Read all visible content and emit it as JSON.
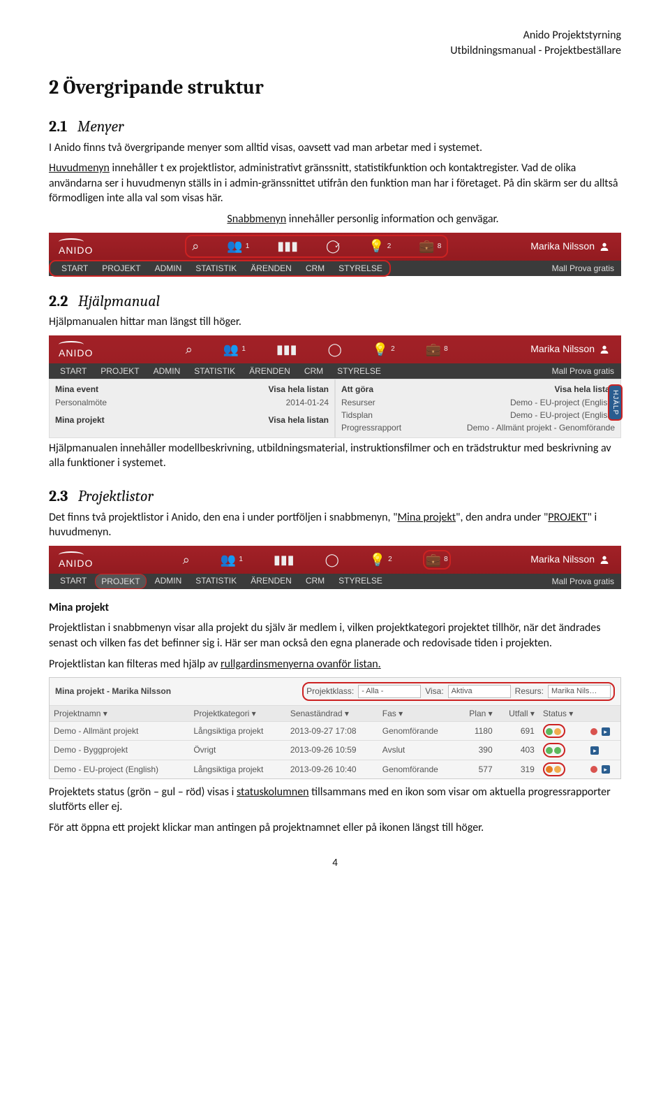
{
  "header": {
    "line1": "Anido Projektstyrning",
    "line2": "Utbildningsmanual - Projektbeställare"
  },
  "sec2": {
    "title": "2  Övergripande struktur",
    "menyer": {
      "num": "2.1",
      "title": "Menyer",
      "p1": "I Anido finns två övergripande menyer som alltid visas, oavsett vad man arbetar med i systemet.",
      "p2a": "Huvudmenyn",
      "p2b": " innehåller t ex projektlistor, administrativt gränssnitt, statistikfunktion och kontaktregister. Vad de olika användarna ser i huvudmenyn ställs in i admin-gränssnittet utifrån den funktion man har i företaget. På din skärm ser du alltså förmodligen inte alla val som visas här.",
      "p3a": "Snabbmenyn",
      "p3b": " innehåller personlig information och genvägar."
    },
    "hjalp": {
      "num": "2.2",
      "title": "Hjälpmanual",
      "p1": "Hjälpmanualen hittar man längst till höger.",
      "p2": "Hjälpmanualen innehåller modellbeskrivning, utbildningsmaterial, instruktionsfilmer och en trädstruktur med beskrivning av alla funktioner i systemet."
    },
    "projektlistor": {
      "num": "2.3",
      "title": "Projektlistor",
      "p1a": "Det finns två projektlistor i Anido, den ena i under portföljen i snabbmenyn, \"",
      "p1b": "Mina projekt",
      "p1c": "\", den andra under \"",
      "p1d": "PROJEKT",
      "p1e": "\" i huvudmenyn.",
      "h4": "Mina projekt",
      "p2": "Projektlistan i snabbmenyn visar alla projekt du själv är medlem i, vilken projektkategori projektet tillhör, när det ändrades senast och vilken fas det befinner sig i. Här ser man också den egna planerade och redovisade tiden i projekten.",
      "p3a": "Projektlistan kan filteras med hjälp av ",
      "p3b": "rullgardinsmenyerna ovanför listan.",
      "p4a": "Projektets status (grön – gul – röd) visas i ",
      "p4b": "statuskolumnen",
      "p4c": " tillsammans med en ikon som visar om aktuella progressrapporter slutförts eller ej.",
      "p5": "För att öppna ett projekt klickar man antingen på projektnamnet eller på ikonen längst till höger."
    }
  },
  "anido": {
    "logo": "ANIDO",
    "icons": {
      "search": "⌕",
      "people": "👥",
      "peoplebadge": "1",
      "chart": "▮▮▮",
      "check": "✓",
      "bulb": "💡",
      "bulbbadge": "2",
      "briefcase": "💼",
      "briefcasebadge": "8"
    },
    "user": "Marika Nilsson",
    "menu": [
      "START",
      "PROJEKT",
      "ADMIN",
      "STATISTIK",
      "ÄRENDEN",
      "CRM",
      "STYRELSE"
    ],
    "menuRight": "Mall Prova gratis",
    "help": "HJÄLP"
  },
  "dash": {
    "left": {
      "title": "Mina event",
      "link": "Visa hela listan",
      "rows": [
        {
          "a": "Personalmöte",
          "b": "2014-01-24"
        }
      ],
      "title2": "Mina projekt",
      "link2": "Visa hela listan"
    },
    "right": {
      "title": "Att göra",
      "link": "Visa hela listan",
      "rows": [
        {
          "a": "Resurser",
          "b": "Demo - EU-project (English)"
        },
        {
          "a": "Tidsplan",
          "b": "Demo - EU-project (English)"
        },
        {
          "a": "Progressrapport",
          "b": "Demo - Allmänt projekt - Genomförande"
        }
      ]
    }
  },
  "projlist": {
    "title": "Mina projekt - Marika Nilsson",
    "filters": {
      "klassLabel": "Projektklass:",
      "klass": "- Alla -",
      "visaLabel": "Visa:",
      "visa": "Aktiva",
      "resursLabel": "Resurs:",
      "resurs": "Marika Nils…"
    },
    "cols": [
      "Projektnamn ▾",
      "Projektkategori ▾",
      "Senaständrad ▾",
      "Fas ▾",
      "Plan ▾",
      "Utfall ▾",
      "Status ▾",
      ""
    ],
    "rows": [
      {
        "name": "Demo - Allmänt projekt",
        "cat": "Långsiktiga projekt",
        "date": "2013-09-27 17:08",
        "fas": "Genomförande",
        "plan": "1180",
        "utfall": "691",
        "status": [
          "green",
          "yellow"
        ]
      },
      {
        "name": "Demo - Byggprojekt",
        "cat": "Övrigt",
        "date": "2013-09-26 10:59",
        "fas": "Avslut",
        "plan": "390",
        "utfall": "403",
        "status": [
          "green",
          "green"
        ]
      },
      {
        "name": "Demo - EU-project (English)",
        "cat": "Långsiktiga projekt",
        "date": "2013-09-26 10:40",
        "fas": "Genomförande",
        "plan": "577",
        "utfall": "319",
        "status": [
          "orange",
          "yellow"
        ]
      }
    ]
  },
  "pagenum": "4"
}
